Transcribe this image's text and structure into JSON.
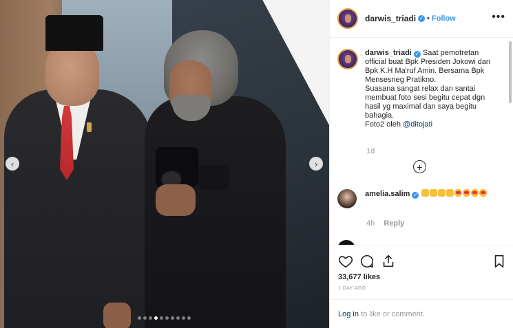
{
  "post": {
    "username": "darwis_triadi",
    "follow_label": "Follow",
    "more_label": "•••",
    "separator": "•",
    "caption": {
      "username": "darwis_triadi",
      "paragraph1": "Saat pemotretan official buat Bpk Presiden Jokowi dan Bpk K.H Ma'ruf Amin. Bersama Bpk Mensesneg Pratikno.",
      "paragraph2": "Suasana sangat relax dan santai membuat foto sesi begitu cepat dgn hasil yg maximal dan saya begitu bahagia.",
      "paragraph3_prefix": "Foto2 oleh",
      "mention": "@ditojati",
      "time": "1d"
    },
    "comment": {
      "username": "amelia.salim",
      "time": "4h",
      "reply_label": "Reply",
      "emojis": [
        "thumb",
        "thumb",
        "thumb",
        "thumb",
        "heart",
        "heart",
        "heart",
        "heart"
      ]
    },
    "likes": "33,677 likes",
    "posted_ago": "1 DAY AGO",
    "login": {
      "link": "Log in",
      "rest": "to like or comment."
    }
  },
  "carousel": {
    "total_slides": 10,
    "active_index": 3
  },
  "icons": [
    "chevron-left-icon",
    "chevron-right-icon",
    "verified-badge-icon",
    "more-options-icon",
    "add-comment-icon",
    "heart-icon",
    "comment-icon",
    "share-icon",
    "bookmark-icon"
  ],
  "colors": {
    "link": "#3897f0",
    "mention": "#003569",
    "verified": "#3897f0",
    "muted": "#999999"
  }
}
